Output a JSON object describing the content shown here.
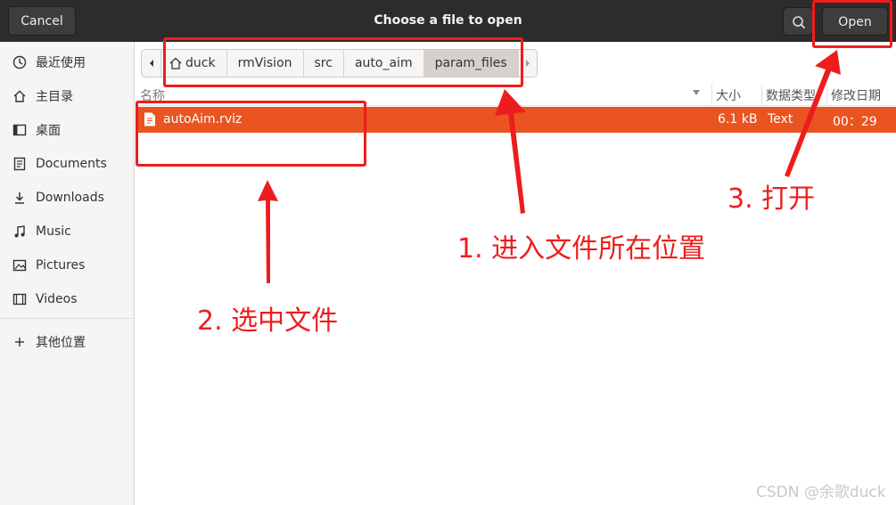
{
  "header": {
    "title": "Choose a file to open",
    "cancel_label": "Cancel",
    "open_label": "Open"
  },
  "sidebar": {
    "items": [
      {
        "label": "最近使用",
        "icon": "clock-icon"
      },
      {
        "label": "主目录",
        "icon": "home-icon"
      },
      {
        "label": "桌面",
        "icon": "desktop-icon"
      },
      {
        "label": "Documents",
        "icon": "documents-icon"
      },
      {
        "label": "Downloads",
        "icon": "download-icon"
      },
      {
        "label": "Music",
        "icon": "music-icon"
      },
      {
        "label": "Pictures",
        "icon": "pictures-icon"
      },
      {
        "label": "Videos",
        "icon": "videos-icon"
      },
      {
        "label": "其他位置",
        "icon": "plus-icon"
      }
    ]
  },
  "pathbar": {
    "segments": [
      "duck",
      "rmVision",
      "src",
      "auto_aim",
      "param_files"
    ],
    "active_segment": "param_files"
  },
  "file_list": {
    "columns": [
      "名称",
      "大小",
      "数据类型",
      "修改日期"
    ],
    "rows": [
      {
        "name": "autoAim.rviz",
        "size": "6.1 kB",
        "type": "Text",
        "modified": "00：29",
        "selected": true
      }
    ]
  },
  "annotations": {
    "step1": "1. 进入文件所在位置",
    "step2": "2. 选中文件",
    "step3": "3. 打开",
    "color": "#ee1d1d"
  },
  "theme": {
    "selection": "#e95420",
    "headerbar": "#2c2c2c"
  },
  "watermark": "CSDN @余歌duck"
}
